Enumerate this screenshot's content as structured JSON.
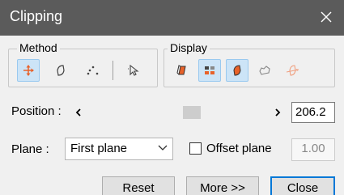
{
  "window": {
    "title": "Clipping"
  },
  "method_group": {
    "legend": "Method",
    "buttons": [
      {
        "icon": "move-plane-icon",
        "active": true
      },
      {
        "icon": "free-plane-icon",
        "active": false
      },
      {
        "icon": "points-icon",
        "active": false
      },
      {
        "icon": "pick-pointer-icon",
        "active": false
      }
    ]
  },
  "display_group": {
    "legend": "Display",
    "buttons": [
      {
        "icon": "solid-cap-icon",
        "active": false
      },
      {
        "icon": "grid-plane-icon",
        "active": true
      },
      {
        "icon": "plane-outline-icon",
        "active": true
      },
      {
        "icon": "contour-icon",
        "active": false
      },
      {
        "icon": "plane-normal-icon",
        "active": false
      }
    ]
  },
  "position": {
    "label": "Position :",
    "value": "206.2",
    "slider_fraction": 0.5
  },
  "plane": {
    "label": "Plane :",
    "selected": "First plane"
  },
  "offset": {
    "label": "Offset plane",
    "checked": false,
    "value": "1.00"
  },
  "buttons": {
    "reset": "Reset",
    "more": "More >>",
    "close": "Close"
  },
  "colors": {
    "titlebar": "#5b5b5b",
    "accent": "#0078d7",
    "icon_orange": "#e8622a",
    "active_bg": "#cce4f7"
  }
}
